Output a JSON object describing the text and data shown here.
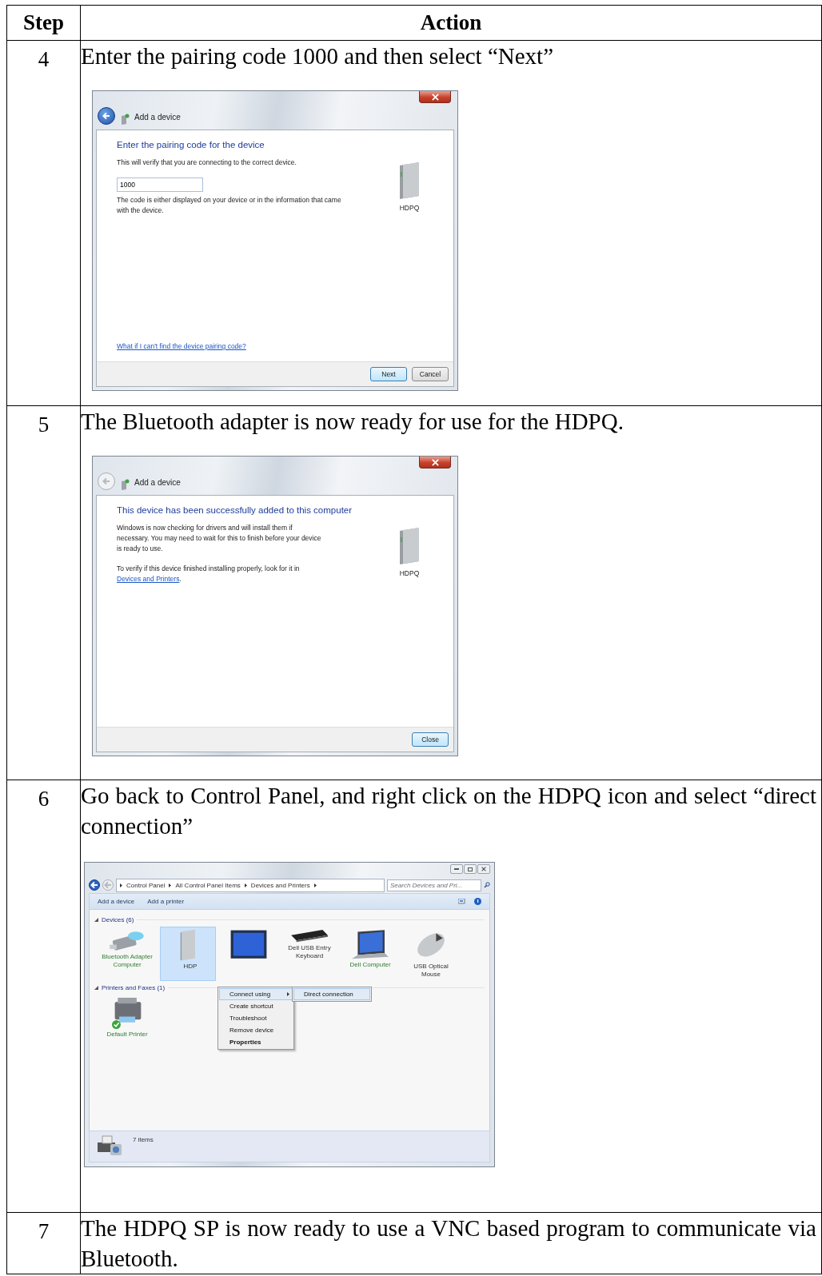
{
  "table": {
    "columns": [
      "Step",
      "Action"
    ],
    "rows": [
      {
        "step": "4",
        "instruction": "Enter the pairing code 1000 and then select “Next”",
        "screenshot": {
          "kind": "wizard",
          "title": "Add a device",
          "back_enabled": true,
          "heading": "Enter the pairing code for the device",
          "paragraphs": [
            {
              "text": "This will verify that you are connecting to the correct device."
            }
          ],
          "field": {
            "value": "1000"
          },
          "note": "The code is either displayed on your device or in the information that came with the device.",
          "device": "HDPQ",
          "help_link": "What if I can't find the device pairing code?",
          "buttons": [
            {
              "label": "Next",
              "default": true
            },
            {
              "label": "Cancel",
              "default": false
            }
          ]
        }
      },
      {
        "step": "5",
        "instruction": "The Bluetooth adapter is now ready for use for the HDPQ.",
        "screenshot": {
          "kind": "wizard",
          "title": "Add a device",
          "back_enabled": false,
          "heading": "This device has been successfully added to this computer",
          "paragraphs": [
            {
              "text": "Windows is now checking for drivers and will install them if necessary. You may need to wait for this to finish before your device is ready to use."
            },
            {
              "text": "To verify if this device finished installing properly, look for it in",
              "link": "Devices and Printers",
              "after": "."
            }
          ],
          "device": "HDPQ",
          "buttons": [
            {
              "label": "Close",
              "default": true
            }
          ]
        }
      },
      {
        "step": "6",
        "instruction": "Go back to Control Panel, and right click on the HDPQ icon and select “direct connection”",
        "screenshot": {
          "kind": "explorer",
          "breadcrumb": [
            "Control Panel",
            "All Control Panel Items",
            "Devices and Printers"
          ],
          "search": {
            "placeholder": "Search Devices and Pri..."
          },
          "commands": [
            "Add a device",
            "Add a printer"
          ],
          "groups": [
            {
              "title": "Devices",
              "count": "(6)",
              "items": [
                {
                  "kind": "usb",
                  "label": "Bluetooth Adapter Computer",
                  "emphasis": true,
                  "selected": false,
                  "default": false
                },
                {
                  "kind": "tower",
                  "label": "HDP",
                  "emphasis": false,
                  "selected": true,
                  "default": false
                },
                {
                  "kind": "monitor",
                  "selected": false,
                  "default": false
                },
                {
                  "kind": "keyboard",
                  "label": "Dell USB Entry Keyboard",
                  "emphasis": false,
                  "selected": false,
                  "default": false
                },
                {
                  "kind": "laptop",
                  "label": "Dell Computer",
                  "emphasis": true,
                  "selected": false,
                  "default": false
                },
                {
                  "kind": "mouse",
                  "label": "USB Optical Mouse",
                  "emphasis": false,
                  "selected": false,
                  "default": false
                }
              ]
            },
            {
              "title": "Printers and Faxes",
              "count": "(1)",
              "items": [
                {
                  "kind": "printer",
                  "label": "Default Printer",
                  "emphasis": true,
                  "selected": false,
                  "default": true
                }
              ]
            }
          ],
          "context_menu": {
            "items": [
              {
                "label": "Connect using",
                "submenu": true,
                "highlighted": true,
                "bold": false
              },
              {
                "label": "Create shortcut",
                "submenu": false,
                "highlighted": false,
                "bold": false
              },
              {
                "label": "Troubleshoot",
                "submenu": false,
                "highlighted": false,
                "bold": false
              },
              {
                "label": "Remove device",
                "submenu": false,
                "highlighted": false,
                "bold": false
              },
              {
                "label": "Properties",
                "submenu": false,
                "highlighted": false,
                "bold": true
              }
            ],
            "submenu": [
              {
                "label": "Direct connection",
                "highlighted": true
              }
            ]
          },
          "status": "7 items"
        }
      },
      {
        "step": "7",
        "instruction": "The HDPQ SP is now ready to use a VNC based program to communicate via Bluetooth."
      }
    ]
  }
}
